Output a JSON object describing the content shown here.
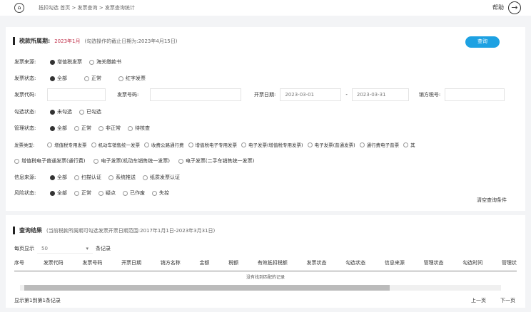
{
  "header": {
    "breadcrumb": "抵扣勾选  首页 > 发票查询 > 发票查询统计",
    "help": "帮助",
    "exit_icon": "exit-icon"
  },
  "query": {
    "title": "税款所属期:",
    "period": "2023年1月",
    "note": "(勾选操作的截止日期为:2023年4月15日)",
    "query_btn": "查询",
    "source": {
      "label": "发票来源:",
      "options": [
        "增值税发票",
        "海关缴款书"
      ],
      "selected": 0
    },
    "status": {
      "label": "发票状态:",
      "options": [
        "全部",
        "正常",
        "红字发票"
      ],
      "selected": 0
    },
    "code_label": "发票代码:",
    "number_label": "发票号码:",
    "date_label": "开票日期:",
    "date_from": "2023-03-01",
    "date_sep": "-",
    "date_to": "2023-03-31",
    "seller_label": "销方税号:",
    "check": {
      "label": "勾选状态:",
      "options": [
        "未勾选",
        "已勾选"
      ],
      "selected": 0
    },
    "manage": {
      "label": "管理状态:",
      "options": [
        "全部",
        "正常",
        "非正常",
        "待核查"
      ],
      "selected": 0
    },
    "type": {
      "label": "发票类型:",
      "options": [
        "增值税专用发票",
        "机动车销售统一发票",
        "收费公路通行费",
        "增值税电子专用发票",
        "电子发票(增值税专用发票)",
        "电子发票(普通发票)",
        "通行费电子普票",
        "其"
      ]
    },
    "type2": {
      "label": "",
      "options": [
        "增值税电子普通发票(通行费)",
        "电子发票(机动车销售统一发票)",
        "电子发票(二手车销售统一发票)"
      ]
    },
    "info": {
      "label": "信息来源:",
      "options": [
        "全部",
        "扫描认证",
        "系统推送",
        "纸质发票认证"
      ],
      "selected": 0
    },
    "risk": {
      "label": "风险状态:",
      "options": [
        "全部",
        "正常",
        "疑点",
        "已作废",
        "失控"
      ],
      "selected": 0
    },
    "clear": "清空查询条件"
  },
  "result": {
    "title": "查询结果",
    "note": "(当前税款所属期可勾选发票开票日期范围:2017年1月1日-2023年3月31日)",
    "page_size_label": "每页显示",
    "page_size": "50",
    "page_size_suffix": "条记录",
    "columns": [
      "序号",
      "发票代码",
      "发票号码",
      "开票日期",
      "销方名称",
      "金额",
      "税额",
      "有效抵扣税额",
      "发票状态",
      "勾选状态",
      "信息来源",
      "管理状态",
      "勾选时间",
      "管理状"
    ],
    "empty": "没有找到匹配的记录",
    "summary": "显示第1到第1条记录",
    "prev": "上一页",
    "next": "下一页"
  }
}
